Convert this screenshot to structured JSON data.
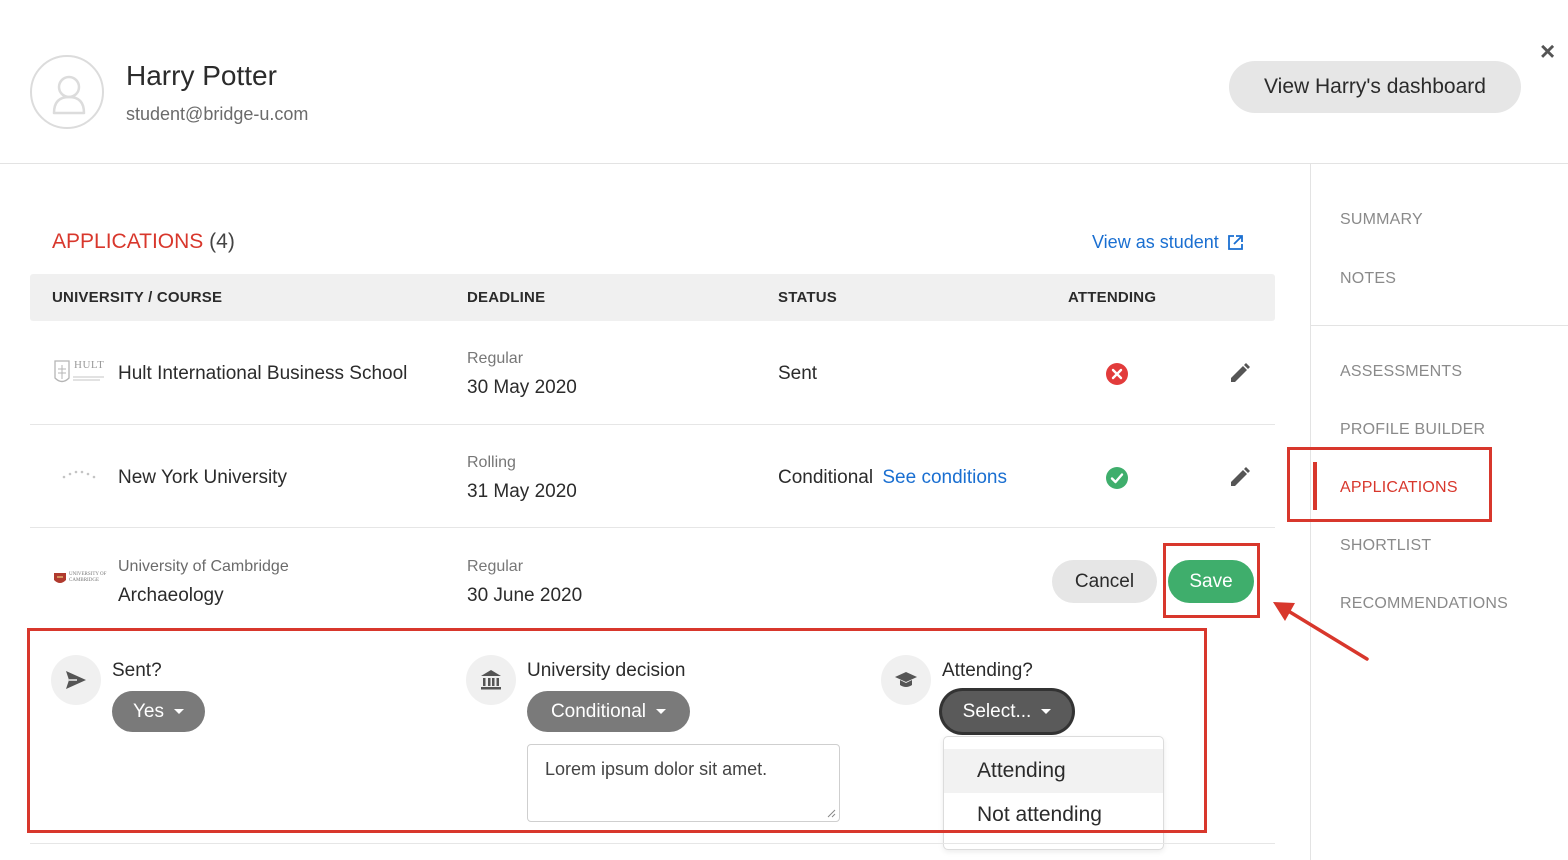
{
  "header": {
    "student_name": "Harry Potter",
    "student_email": "student@bridge-u.com",
    "dashboard_button": "View Harry's dashboard",
    "close_label": "×"
  },
  "nav": {
    "items": [
      "SUMMARY",
      "NOTES",
      "ASSESSMENTS",
      "PROFILE BUILDER",
      "APPLICATIONS",
      "SHORTLIST",
      "RECOMMENDATIONS"
    ],
    "active": "APPLICATIONS"
  },
  "applications": {
    "title": "APPLICATIONS",
    "count": "(4)",
    "view_as_student": "View as student",
    "columns": [
      "UNIVERSITY / COURSE",
      "DEADLINE",
      "STATUS",
      "ATTENDING"
    ],
    "rows": [
      {
        "logo_text": "HULT",
        "university": "Hult International Business School",
        "deadline_type": "Regular",
        "deadline_date": "30 May 2020",
        "status": "Sent",
        "status_link": "",
        "attending": "no"
      },
      {
        "logo_text": "",
        "university": "New York University",
        "deadline_type": "Rolling",
        "deadline_date": "31 May 2020",
        "status": "Conditional",
        "status_link": "See conditions",
        "attending": "yes"
      },
      {
        "logo_text": "UNIVERSITY OF CAMBRIDGE",
        "university": "University of Cambridge",
        "course": "Archaeology",
        "deadline_type": "Regular",
        "deadline_date": "30 June 2020"
      }
    ],
    "cancel_label": "Cancel",
    "save_label": "Save"
  },
  "edit": {
    "sent_label": "Sent?",
    "sent_value": "Yes",
    "decision_label": "University decision",
    "decision_value": "Conditional",
    "decision_note": "Lorem ipsum dolor sit amet.",
    "attending_label": "Attending?",
    "attending_value": "Select...",
    "attending_options": [
      "Attending",
      "Not attending"
    ]
  },
  "colors": {
    "accent_red": "#d8372c",
    "link_blue": "#1a6fd1",
    "save_green": "#3fae6c",
    "error_red": "#e23b3b",
    "success_green": "#3fae6c"
  }
}
